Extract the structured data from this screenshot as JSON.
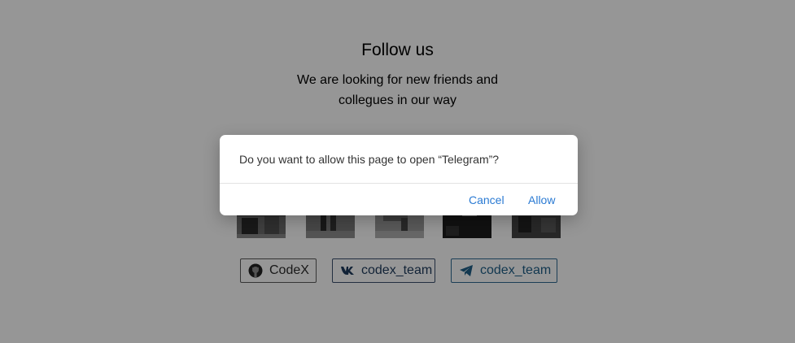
{
  "follow": {
    "title": "Follow us",
    "subtitle_line1": "We are looking for new friends and",
    "subtitle_line2": "collegues in our way"
  },
  "photos": [
    {
      "name": "team-photo-1"
    },
    {
      "name": "team-photo-2"
    },
    {
      "name": "team-photo-3"
    },
    {
      "name": "team-photo-4"
    },
    {
      "name": "team-photo-5"
    }
  ],
  "social": {
    "github": {
      "label": "CodeX",
      "icon": "github-icon"
    },
    "vk": {
      "label": "codex_team",
      "icon": "vk-icon"
    },
    "telegram": {
      "label": "codex_team",
      "icon": "telegram-icon"
    }
  },
  "dialog": {
    "message": "Do you want to allow this page to open “Telegram”?",
    "cancel_label": "Cancel",
    "allow_label": "Allow"
  },
  "colors": {
    "overlay": "#949494",
    "dialog_button": "#2a7ad3"
  }
}
